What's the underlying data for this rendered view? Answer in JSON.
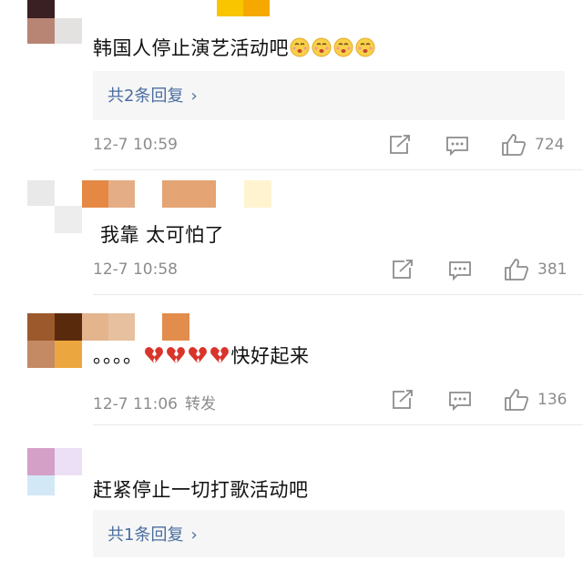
{
  "comments": [
    {
      "text": "韩国人停止演艺活动吧",
      "emoji": "kiss-face-emoji",
      "reply_link": "共2条回复",
      "time": "12-7 10:59",
      "repost": "",
      "likes": "724"
    },
    {
      "text": "我靠 太可怕了",
      "time": "12-7 10:58",
      "repost": "",
      "likes": "381"
    },
    {
      "text_prefix": "。。。。",
      "emoji": "broken-heart-emoji",
      "text_suffix": "快好起来",
      "time": "12-7 11:06",
      "repost": "转发",
      "likes": "136"
    },
    {
      "text": "赶紧停止一切打歌活动吧",
      "reply_link": "共1条回复"
    }
  ],
  "colors": {
    "reply_link": "#4a6ea0",
    "meta": "#8c8c8c",
    "reply_bg": "#f6f6f6"
  }
}
